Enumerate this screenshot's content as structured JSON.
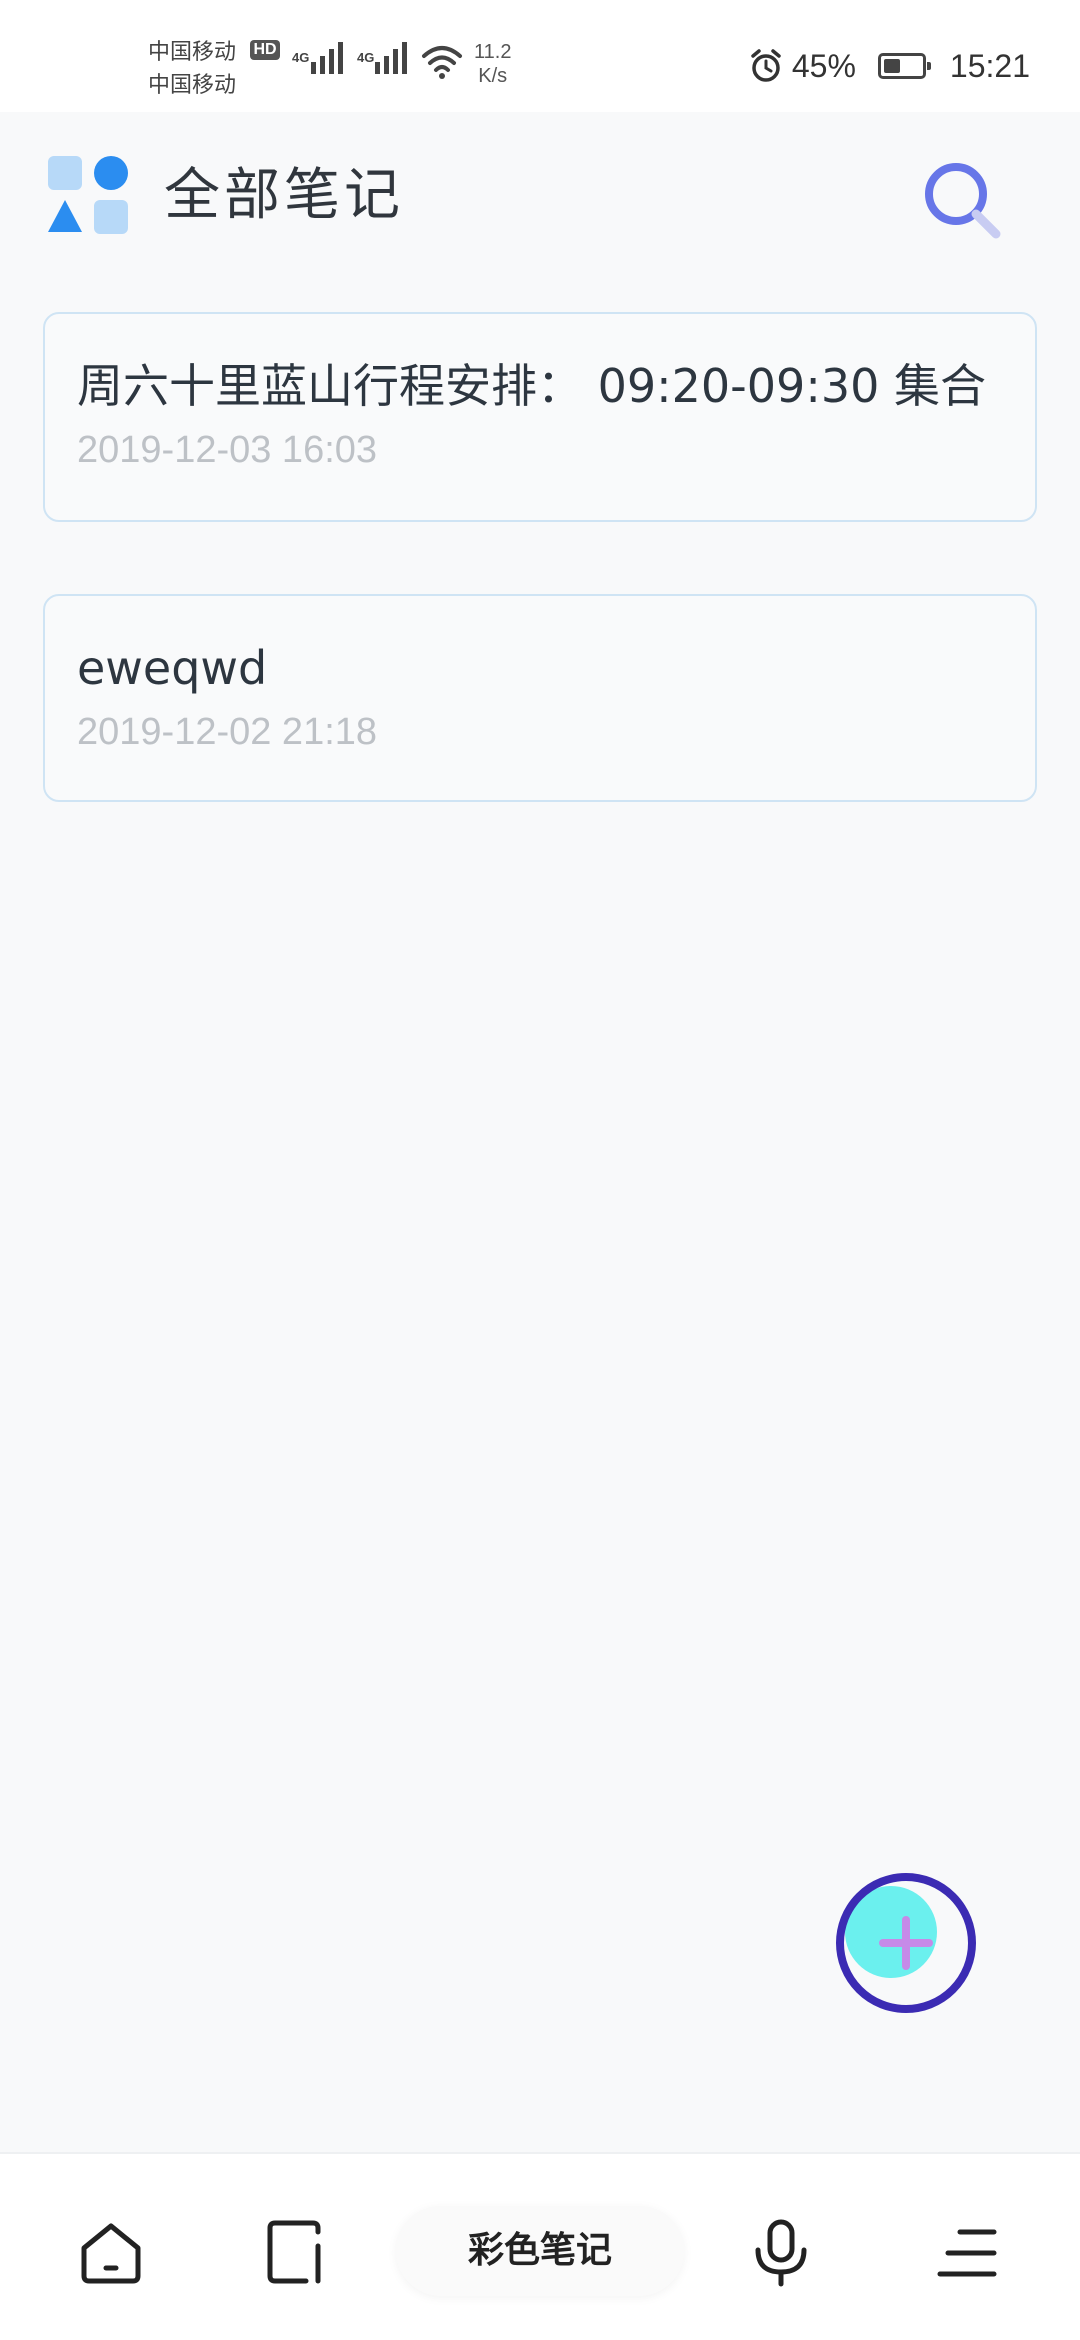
{
  "status_bar": {
    "carrier_1": "中国移动",
    "carrier_2": "中国移动",
    "hd_badge": "HD",
    "network_1": "4G",
    "network_2": "4G",
    "speed_value": "11.2",
    "speed_unit": "K/s",
    "battery_percent": "45%",
    "battery_level": 0.45,
    "time": "15:21"
  },
  "header": {
    "title": "全部笔记",
    "logo_icon": "app-logo-icon",
    "search_icon": "search-icon"
  },
  "notes": [
    {
      "title": "周六十里蓝山行程安排： 09:20-09:30 集合",
      "date": "2019-12-03 16:03"
    },
    {
      "title": "eweqwd",
      "date": "2019-12-02 21:18"
    }
  ],
  "fab": {
    "icon": "plus-icon"
  },
  "bottom_nav": {
    "home_icon": "home-icon",
    "tablet_icon": "tablet-icon",
    "center_label": "彩色笔记",
    "mic_icon": "microphone-icon",
    "menu_icon": "menu-icon"
  },
  "colors": {
    "accent_blue": "#2b8df0",
    "light_blue": "#b7d9f8",
    "search_purple": "#6776e8",
    "fab_ring": "#3b2bb3",
    "fab_fill": "#6bf0ee",
    "fab_plus": "#c68ae8",
    "card_border": "#cfe4f4"
  }
}
